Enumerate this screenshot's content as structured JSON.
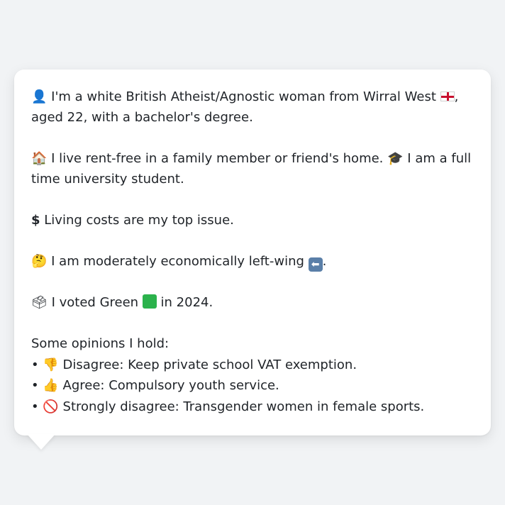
{
  "profile": {
    "identity": {
      "icon": "person-silhouette-icon",
      "text_before_flag": "I'm a white British Atheist/Agnostic woman from Wirral West",
      "flag_icon": "england-flag-icon",
      "text_after_flag": ", aged 22, with a bachelor's degree."
    },
    "housing": {
      "icon": "house-icon",
      "text": "I live rent-free in a family member or friend's home.",
      "study_icon": "graduation-cap-icon",
      "study_text": "I am a full time university student."
    },
    "issue": {
      "icon": "dollar-sign-icon",
      "text": "Living costs are my top issue."
    },
    "economics": {
      "icon": "thinking-face-icon",
      "text": "I am moderately economically left-wing",
      "arrow_icon": "left-arrow-icon",
      "suffix": "."
    },
    "vote": {
      "icon": "ballot-box-icon",
      "text_before": "I voted Green",
      "party_icon": "green-square-icon",
      "text_after": "in 2024."
    },
    "opinions": {
      "heading": "Some opinions I hold:",
      "items": [
        {
          "bullet": "•",
          "icon": "thumbs-down-icon",
          "text": "Disagree: Keep private school VAT exemption."
        },
        {
          "bullet": "•",
          "icon": "thumbs-up-icon",
          "text": "Agree: Compulsory youth service."
        },
        {
          "bullet": "•",
          "icon": "prohibited-icon",
          "text": "Strongly disagree: Transgender women in female sports."
        }
      ]
    }
  },
  "colors": {
    "background": "#f1f3f5",
    "card": "#ffffff",
    "text": "#1f2328",
    "flag_red": "#c8102e",
    "green": "#2bb24c"
  }
}
